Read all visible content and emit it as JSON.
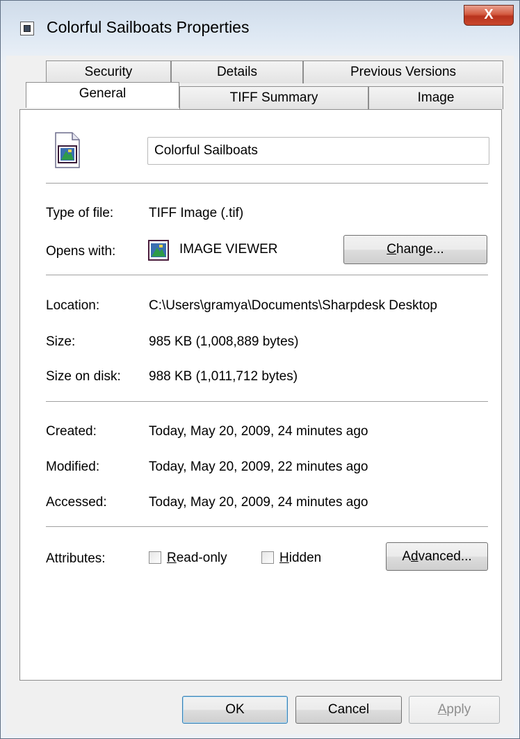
{
  "window": {
    "title": "Colorful Sailboats Properties",
    "close_label": "X"
  },
  "tabs_row1": [
    "Security",
    "Details",
    "Previous Versions"
  ],
  "tabs_row2": [
    "General",
    "TIFF Summary",
    "Image"
  ],
  "active_tab": "General",
  "general": {
    "file_name": "Colorful Sailboats",
    "type_label": "Type of file:",
    "type_value": "TIFF Image (.tif)",
    "opens_label": "Opens with:",
    "opens_value": "IMAGE VIEWER",
    "change_pre": "",
    "change_ul": "C",
    "change_post": "hange...",
    "location_label": "Location:",
    "location_value": "C:\\Users\\gramya\\Documents\\Sharpdesk Desktop",
    "size_label": "Size:",
    "size_value": "985 KB (1,008,889 bytes)",
    "size_on_disk_label": "Size on disk:",
    "size_on_disk_value": "988 KB (1,011,712 bytes)",
    "created_label": "Created:",
    "created_value": "Today, May 20, 2009, 24 minutes ago",
    "modified_label": "Modified:",
    "modified_value": "Today, May 20, 2009, 22 minutes ago",
    "accessed_label": "Accessed:",
    "accessed_value": "Today, May 20, 2009, 24 minutes ago",
    "attributes_label": "Attributes:",
    "readonly_ul": "R",
    "readonly_post": "ead-only",
    "readonly_checked": false,
    "hidden_ul": "H",
    "hidden_post": "idden",
    "hidden_checked": false,
    "advanced_pre": "A",
    "advanced_ul": "d",
    "advanced_post": "vanced..."
  },
  "footer": {
    "ok_label": "OK",
    "cancel_label": "Cancel",
    "apply_ul": "A",
    "apply_post": "pply"
  }
}
